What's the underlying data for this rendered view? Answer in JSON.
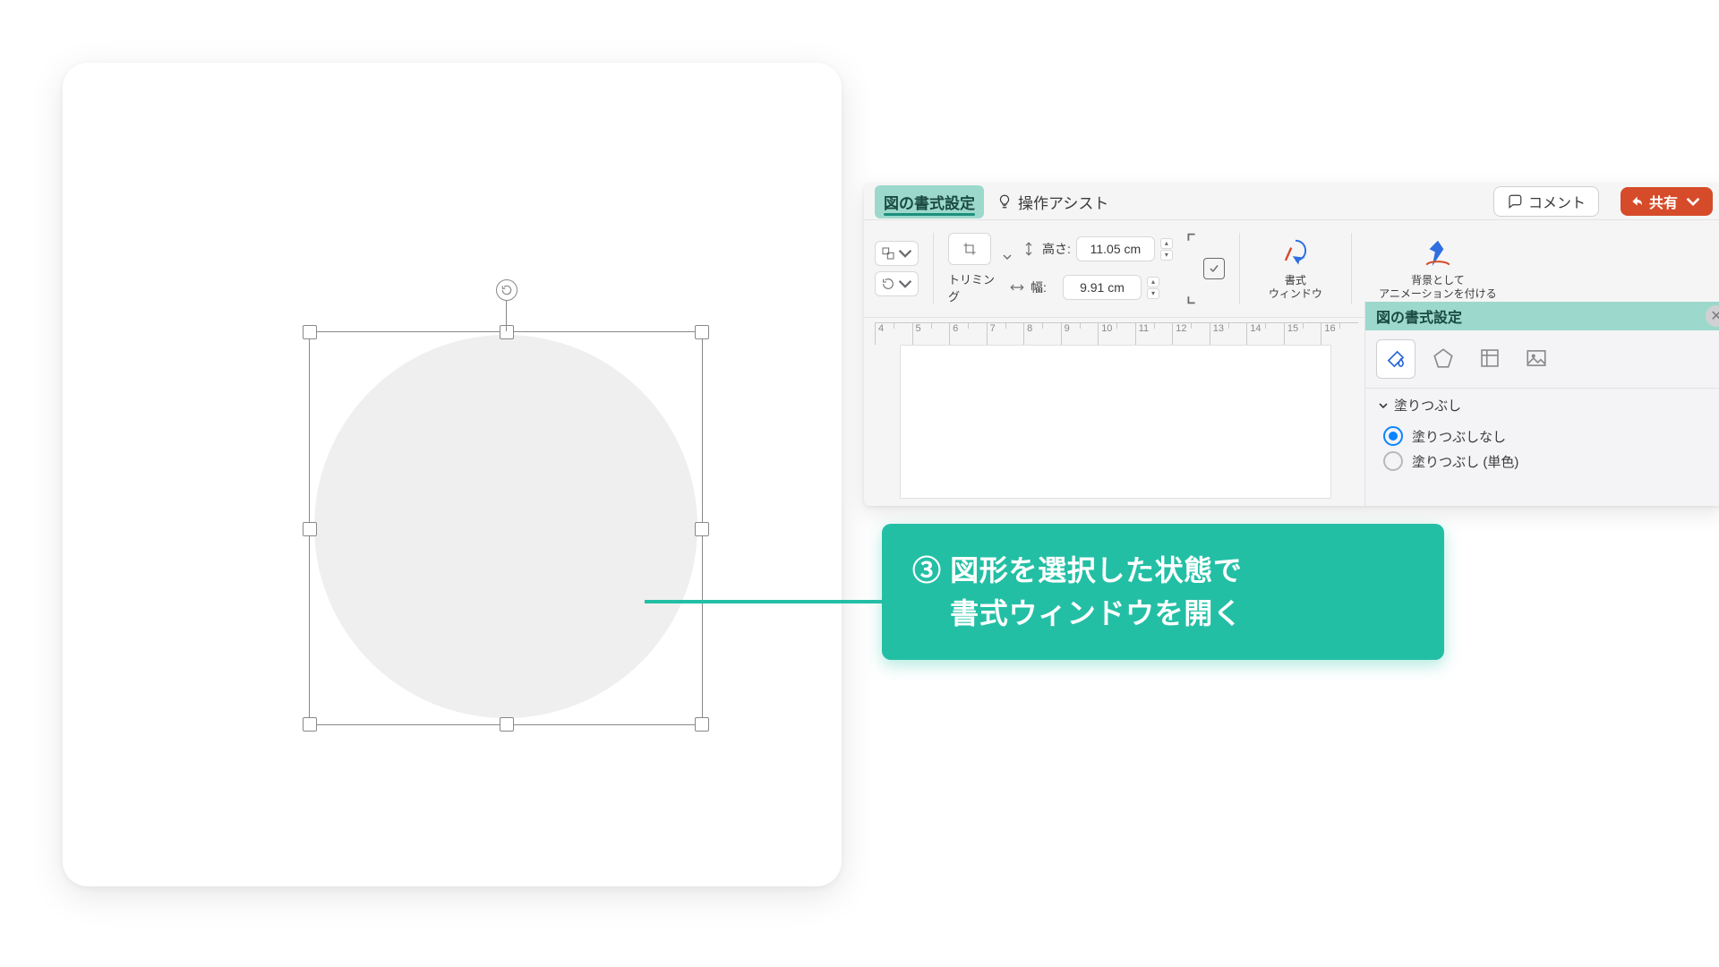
{
  "tabs": {
    "format_picture": "図の書式設定",
    "assist": "操作アシスト"
  },
  "topright": {
    "comment": "コメント",
    "share": "共有"
  },
  "ribbon": {
    "crop": "トリミング",
    "height_label": "高さ:",
    "height_value": "11.05 cm",
    "width_label": "幅:",
    "width_value": "9.91 cm",
    "format_window_l1": "書式",
    "format_window_l2": "ウィンドウ",
    "bg_anim_l1": "背景として",
    "bg_anim_l2": "アニメーションを付ける"
  },
  "ruler_ticks": [
    "4",
    "5",
    "6",
    "7",
    "8",
    "9",
    "10",
    "11",
    "12",
    "13",
    "14",
    "15",
    "16"
  ],
  "side_panel": {
    "title": "図の書式設定",
    "section": "塗りつぶし",
    "opt_none": "塗りつぶしなし",
    "opt_solid": "塗りつぶし (単色)"
  },
  "callout": {
    "line1": "③ 図形を選択した状態で",
    "line2": "　 書式ウィンドウを開く"
  }
}
